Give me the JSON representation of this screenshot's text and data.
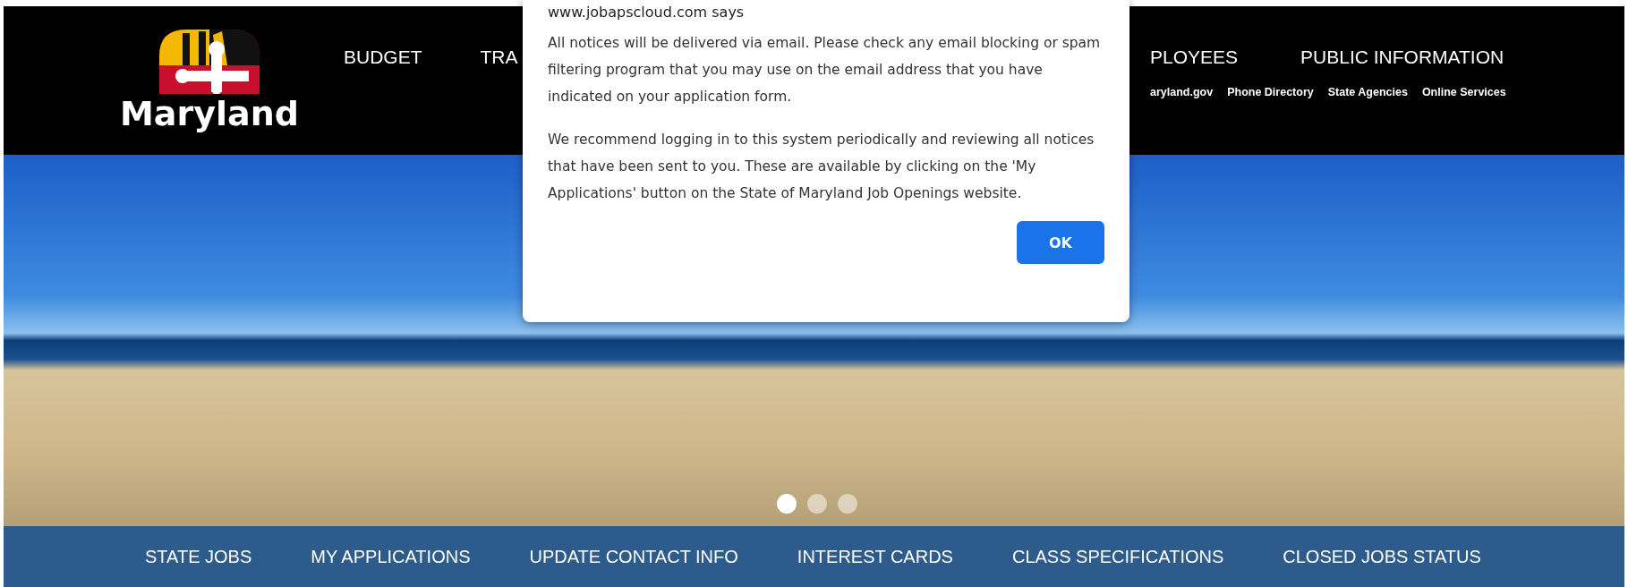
{
  "header": {
    "logo_text": "Maryland",
    "nav_left": [
      "BUDGET",
      "TRA"
    ],
    "nav_right": [
      "PLOYEES",
      "PUBLIC INFORMATION"
    ],
    "links": [
      "aryland.gov",
      "Phone Directory",
      "State Agencies",
      "Online Services"
    ]
  },
  "carousel": {
    "dots": [
      {
        "selected": true
      },
      {
        "selected": false
      },
      {
        "selected": false
      }
    ]
  },
  "bottom_nav": [
    "STATE JOBS",
    "MY APPLICATIONS",
    "UPDATE CONTACT INFO",
    "INTEREST CARDS",
    "CLASS SPECIFICATIONS",
    "CLOSED JOBS STATUS"
  ],
  "dialog": {
    "title": "www.jobapscloud.com says",
    "paragraphs": [
      "All notices will be delivered via email.  Please check any email blocking or spam filtering program that you may use on the email address that you have indicated on your application form.",
      "We recommend logging in to this system periodically and reviewing all notices that have been sent to you.  These are available by clicking on the 'My Applications' button on the State of Maryland Job Openings website."
    ],
    "button": "OK"
  }
}
